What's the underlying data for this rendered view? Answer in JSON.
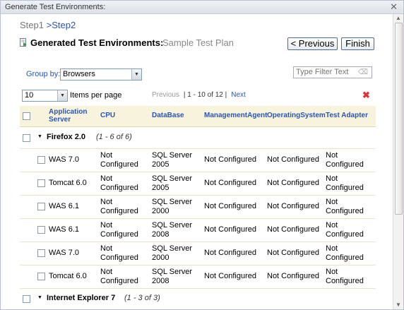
{
  "window": {
    "title": "Generate Test Environments:"
  },
  "breadcrumb": {
    "step1": "Step1",
    "step2": ">Step2"
  },
  "header": {
    "title": "Generated Test Environments:",
    "subtitle": "Sample Test Plan"
  },
  "buttons": {
    "previous": "< Previous",
    "finish": "Finish"
  },
  "groupby": {
    "label": "Group by:",
    "value": "Browsers"
  },
  "filter": {
    "placeholder": "Type Filter Text"
  },
  "paging": {
    "page_size": "10",
    "items_per_page": "Items per page",
    "previous": "Previous",
    "range": "| 1 - 10 of 12 |",
    "next": "Next"
  },
  "columns": [
    "Application Server",
    "CPU",
    "DataBase",
    "ManagementAgent",
    "OperatingSystem",
    "Test Adapter"
  ],
  "groups": [
    {
      "name": "Firefox 2.0",
      "count": "(1 - 6 of 6)",
      "rows": [
        [
          "WAS 7.0",
          "Not Configured",
          "SQL Server 2005",
          "Not Configured",
          "Not Configured",
          "Not Configured"
        ],
        [
          "Tomcat 6.0",
          "Not Configured",
          "SQL Server 2005",
          "Not Configured",
          "Not Configured",
          "Not Configured"
        ],
        [
          "WAS 6.1",
          "Not Configured",
          "SQL Server 2000",
          "Not Configured",
          "Not Configured",
          "Not Configured"
        ],
        [
          "WAS 6.1",
          "Not Configured",
          "SQL Server 2008",
          "Not Configured",
          "Not Configured",
          "Not Configured"
        ],
        [
          "WAS 7.0",
          "Not Configured",
          "SQL Server 2000",
          "Not Configured",
          "Not Configured",
          "Not Configured"
        ],
        [
          "Tomcat 6.0",
          "Not Configured",
          "SQL Server 2008",
          "Not Configured",
          "Not Configured",
          "Not Configured"
        ]
      ]
    },
    {
      "name": "Internet Explorer 7",
      "count": "(1 - 3 of 3)",
      "rows": []
    }
  ],
  "icons": {
    "close": "close-icon",
    "doc": "document-icon",
    "delete": "delete-icon",
    "eraser": "eraser-icon"
  }
}
